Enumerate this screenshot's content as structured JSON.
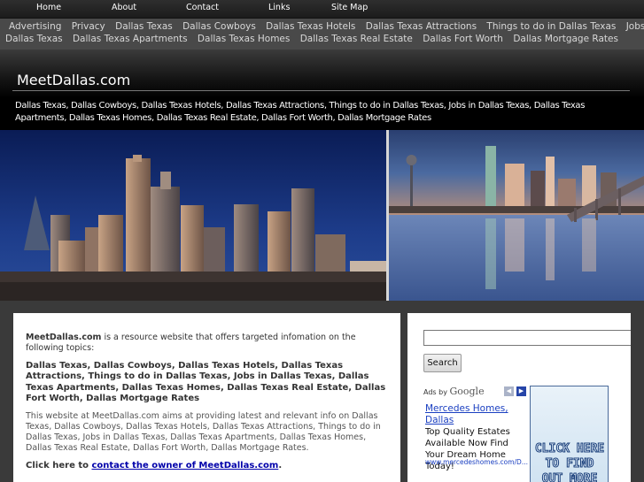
{
  "topnav": {
    "home": "Home",
    "about": "About",
    "contact": "Contact",
    "links": "Links",
    "sitemap": "Site Map"
  },
  "links_strip": [
    "Advertising",
    "Privacy",
    "Dallas Texas",
    "Dallas Cowboys",
    "Dallas Texas Hotels",
    "Dallas Texas Attractions",
    "Things to do in Dallas Texas",
    "Jobs in Dallas Texas",
    "Dallas Texas Apartments",
    "Dallas Texas Homes",
    "Dallas Texas Real Estate",
    "Dallas Fort Worth",
    "Dallas Mortgage Rates"
  ],
  "header": {
    "site_title": "MeetDallas.com",
    "topics": "Dallas Texas, Dallas Cowboys, Dallas Texas Hotels, Dallas Texas Attractions, Things to do in Dallas Texas, Jobs in Dallas Texas, Dallas Texas Apartments, Dallas Texas Homes, Dallas Texas Real Estate, Dallas Fort Worth, Dallas Mortgage Rates"
  },
  "content": {
    "site_name": "MeetDallas.com",
    "intro_rest": " is a resource website that offers targeted infomation on the following topics:",
    "topics_bold": "Dallas Texas, Dallas Cowboys, Dallas Texas Hotels, Dallas Texas Attractions, Things to do in Dallas Texas, Jobs in Dallas Texas, Dallas Texas Apartments, Dallas Texas Homes, Dallas Texas Real Estate, Dallas Fort Worth, Dallas Mortgage Rates",
    "body": "This website at MeetDallas.com aims at providing latest and relevant info on Dallas Texas, Dallas Cowboys, Dallas Texas Hotels, Dallas Texas Attractions, Things to do in Dallas Texas, Jobs in Dallas Texas, Dallas Texas Apartments, Dallas Texas Homes, Dallas Texas Real Estate, Dallas Fort Worth, Dallas Mortgage Rates.",
    "contact_prefix": "Click here to ",
    "contact_link": "contact the owner of MeetDallas.com",
    "contact_suffix": "."
  },
  "sidebar": {
    "search_placeholder": "",
    "search_button": "Search",
    "ads_by": "Ads by",
    "google": "Google",
    "ad_title": "Mercedes Homes, Dallas",
    "ad_desc": "Top Quality Estates Available Now Find Your Dream Home Today!",
    "ad_url": "www.mercedeshomes.com/D...",
    "banner_ad_text": "CLICK HERE TO FIND OUT MORE"
  },
  "colors": {
    "nav_bg": "#1c1c1c",
    "links_strip_bg": "#494949",
    "page_bg": "#3a3a3a",
    "ad_link": "#1a3fc1",
    "contact_link": "#0000aa"
  }
}
